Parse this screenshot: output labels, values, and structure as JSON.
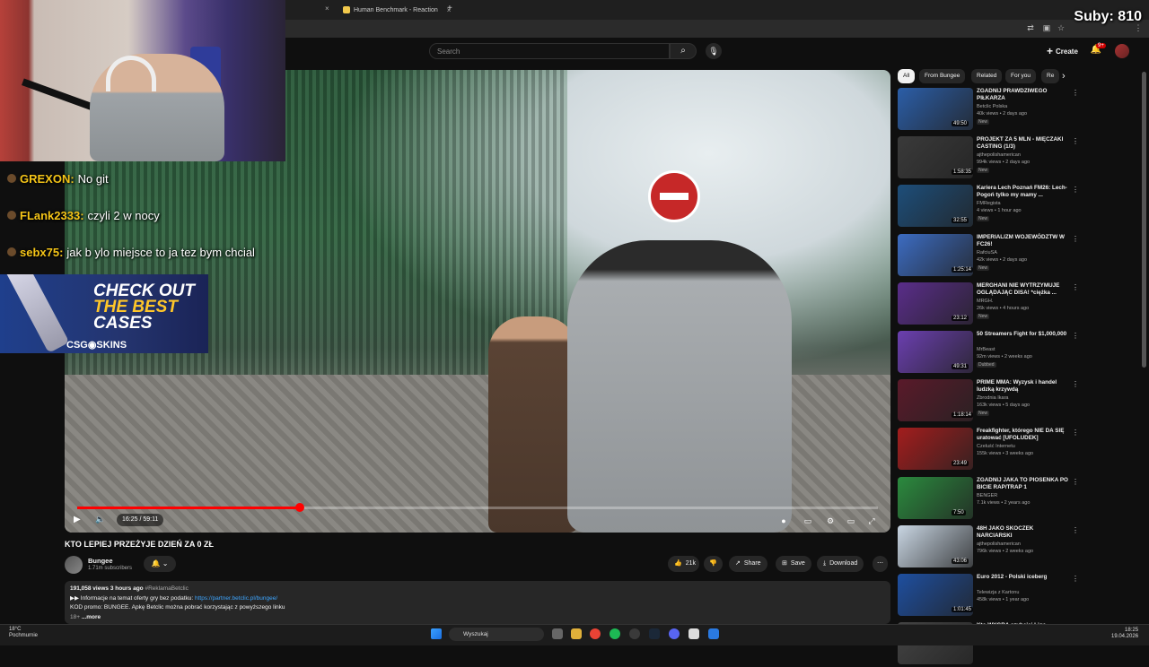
{
  "browser": {
    "tabs": [
      {
        "label": "Human Benchmark - Reaction"
      }
    ]
  },
  "overlay": {
    "subs_counter": "Suby: 810",
    "chat": [
      {
        "nick": "GREXON:",
        "text": "No git"
      },
      {
        "nick": "FLank2333:",
        "text": "czyli 2 w nocy"
      },
      {
        "nick": "sebx75:",
        "text": "jak b   ylo miejsce to ja tez bym chcial"
      }
    ],
    "ad": {
      "line1": "CHECK OUT",
      "line2": "THE BEST",
      "line3": "CASES",
      "brand": "CSG◉SKINS"
    }
  },
  "header": {
    "search_placeholder": "Search",
    "create_label": "Create",
    "notif_badge": "9+"
  },
  "player": {
    "current_time": "16:25",
    "duration": "59:11",
    "time_display": "16:25 / 59:11",
    "progress": 0.2775
  },
  "video": {
    "title": "KTO LEPIEJ PRZEŻYJE DZIEŃ ZA 0 ZŁ",
    "channel": "Bungee",
    "subscribers": "1.71m subscribers",
    "likes": "21k",
    "share_label": "Share",
    "save_label": "Save",
    "download_label": "Download",
    "description": {
      "stats": "191,058 views  3 hours ago",
      "hashtag": "#ReklamaBetclic",
      "line2_prefix": "▶▶ Informacje na temat oferty gry bez podatku:",
      "link": "https://partner.betclic.pl/bungee/",
      "line3": "KOD promo: BUNGEE. Apkę Betclic można pobrać korzystając z powyższego linku",
      "line4_prefix": "18+",
      "more": "...more"
    }
  },
  "sidebar": {
    "chips": [
      "All",
      "From Bungee",
      "Related",
      "For you",
      "Re"
    ],
    "recommendations": [
      {
        "title": "ZGADNIJ PRAWDZIWEGO PIŁKARZA",
        "channel": "Betclic Polska",
        "meta": "40k views • 2 days ago",
        "badge": "New",
        "duration": "49:50",
        "color": "#2b5ea8"
      },
      {
        "title": "PROJEKT ZA 5 MLN - MIĘCZAKI CASTING (1/3)",
        "channel": "ajthepolishamerican",
        "meta": "994k views • 2 days ago",
        "badge": "New",
        "duration": "1:58:35",
        "color": "#3a3a3a"
      },
      {
        "title": "Kariera Lech Poznań FM26: Lech-Pogoń tylko my mamy ...",
        "channel": "FMRegista",
        "meta": "4 views • 1 hour ago",
        "badge": "New",
        "duration": "32:55",
        "color": "#1d4e7a"
      },
      {
        "title": "IMPERIALIZM WOJEWÓDZTW W FC26!",
        "channel": "RafciuSA",
        "meta": "42k views • 2 days ago",
        "badge": "New",
        "duration": "1:25:14",
        "color": "#3c6cc2"
      },
      {
        "title": "MERGHANI NIE WYTRZYMUJE OGLĄDAJĄC DISA! *ciężka ...",
        "channel": "MRGH.",
        "meta": "26k views • 4 hours ago",
        "badge": "New",
        "duration": "23:12",
        "color": "#5a2d8a"
      },
      {
        "title": "50 Streamers Fight for $1,000,000",
        "channel": "MrBeast",
        "meta": "92m views • 2 weeks ago",
        "badge": "Dubbed",
        "duration": "49:31",
        "color": "#6b3fb0"
      },
      {
        "title": "PRIME MMA: Wyzysk i handel ludzką krzywdą",
        "channel": "Zbrodnia Ikara",
        "meta": "163k views • 5 days ago",
        "badge": "New",
        "duration": "1:18:14",
        "color": "#5a1a2a"
      },
      {
        "title": "Freakfighter, którego NIE DA SIĘ uratować [UFOLUDEK]",
        "channel": "Czeluść Internetu",
        "meta": "155k views • 3 weeks ago",
        "badge": "",
        "duration": "23:49",
        "color": "#a31d1d"
      },
      {
        "title": "ZGADNIJ JAKA TO PIOSENKA PO BICIE RAP/TRAP 1",
        "channel": "BENGER",
        "meta": "7.1k views • 2 years ago",
        "badge": "",
        "duration": "7:50",
        "color": "#2b8a3e"
      },
      {
        "title": "48H JAKO SKOCZEK NARCIARSKI",
        "channel": "ajthepolishamerican",
        "meta": "796k views • 2 weeks ago",
        "badge": "",
        "duration": "43:06",
        "color": "#c9d6e3"
      },
      {
        "title": "Euro 2012 - Polski iceberg",
        "channel": "Telewizja z Kartonu",
        "meta": "458k views • 1 year ago",
        "badge": "",
        "duration": "1:01:45",
        "color": "#1e4fa0"
      },
      {
        "title": "Kto WYGRA szybciej Ligę",
        "channel": "",
        "meta": "",
        "badge": "",
        "duration": "",
        "color": "#444"
      }
    ]
  },
  "taskbar": {
    "weather_temp": "18°C",
    "weather_desc": "Pochmurnie",
    "search_label": "Wyszukaj",
    "time": "18:25",
    "date": "19.04.2026"
  }
}
